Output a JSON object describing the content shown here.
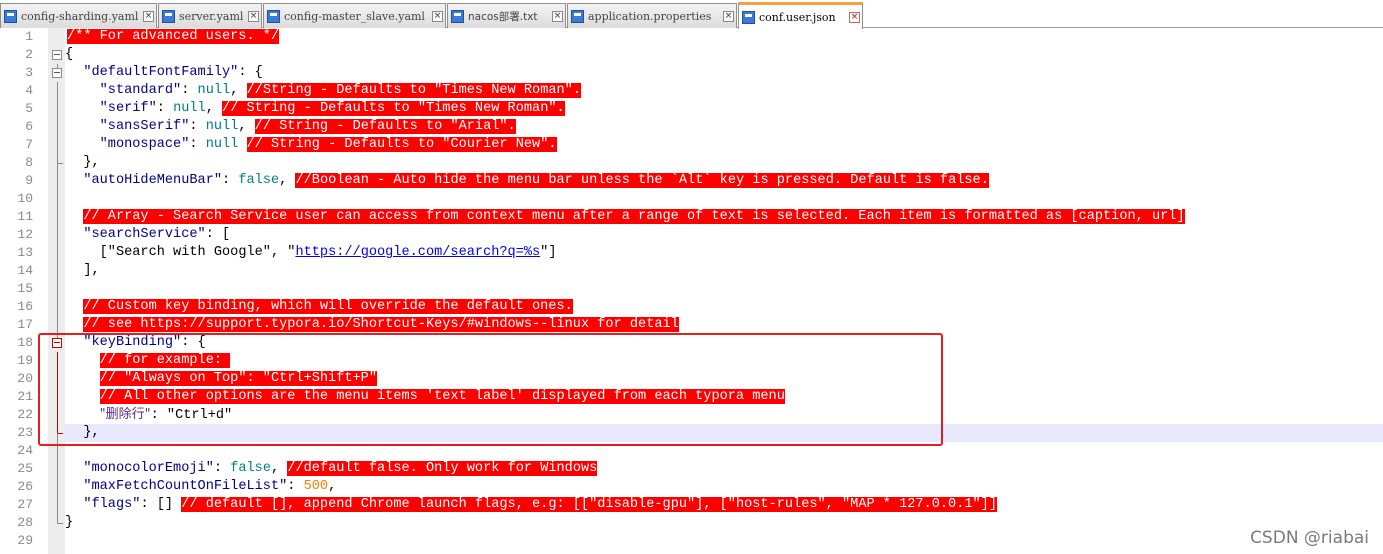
{
  "tabs": [
    {
      "label": "config-sharding.yaml",
      "active": false
    },
    {
      "label": "server.yaml",
      "active": false
    },
    {
      "label": "config-master_slave.yaml",
      "active": false
    },
    {
      "label": "nacos部署.txt",
      "active": false
    },
    {
      "label": "application.properties",
      "active": false
    },
    {
      "label": "conf.user.json",
      "active": true
    }
  ],
  "editor": {
    "lines": {
      "l1_comment": "/** For advanced users. */",
      "l2_brace": "{",
      "l3_key": "\"defaultFontFamily\"",
      "l3_rest": ": {",
      "l4_key": "\"standard\"",
      "l4_sep": ": ",
      "l4_val": "null",
      "l4_comma": ", ",
      "l4_comment": "//String - Defaults to \"Times New Roman\".",
      "l5_key": "\"serif\"",
      "l5_sep": ": ",
      "l5_val": "null",
      "l5_comma": ", ",
      "l5_comment": "// String - Defaults to \"Times New Roman\".",
      "l6_key": "\"sansSerif\"",
      "l6_sep": ": ",
      "l6_val": "null",
      "l6_comma": ", ",
      "l6_comment": "// String - Defaults to \"Arial\".",
      "l7_key": "\"monospace\"",
      "l7_sep": ": ",
      "l7_val": "null",
      "l7_comma": " ",
      "l7_comment": "// String - Defaults to \"Courier New\".",
      "l8_text": "},",
      "l9_key": "\"autoHideMenuBar\"",
      "l9_sep": ": ",
      "l9_val": "false",
      "l9_comma": ", ",
      "l9_comment": "//Boolean - Auto hide the menu bar unless the `Alt` key is pressed. Default is false.",
      "l11_comment": "// Array - Search Service user can access from context menu after a range of text is selected. Each item is formatted as [caption, url]",
      "l12_key": "\"searchService\"",
      "l12_rest": ": [",
      "l13_pre": "[\"Search with Google\", \"",
      "l13_url": "https://google.com/search?q=%s",
      "l13_post": "\"]",
      "l14_text": "],",
      "l16_comment": "// Custom key binding, which will override the default ones.",
      "l17_comment": "// see https://support.typora.io/Shortcut-Keys/#windows--linux for detail",
      "l18_key": "\"keyBinding\"",
      "l18_rest": ": {",
      "l19_comment": "// for example: ",
      "l20_comment": "// \"Always on Top\": \"Ctrl+Shift+P\"",
      "l21_comment": "// All other options are the menu items 'text label' displayed from each typora menu",
      "l22_key": "\"删除行\"",
      "l22_rest": ": \"Ctrl+d\"",
      "l23_text": "},",
      "l25_key": "\"monocolorEmoji\"",
      "l25_sep": ": ",
      "l25_val": "false",
      "l25_comma": ", ",
      "l25_comment": "//default false. Only work for Windows",
      "l26_key": "\"maxFetchCountOnFileList\"",
      "l26_sep": ": ",
      "l26_val": "500",
      "l26_comma": ",",
      "l27_key": "\"flags\"",
      "l27_rest": ": [] ",
      "l27_comment": "// default [], append Chrome launch flags, e.g: [[\"disable-gpu\"], [\"host-rules\", \"MAP * 127.0.0.1\"]]",
      "l28_text": "}"
    }
  },
  "line_numbers": [
    "1",
    "2",
    "3",
    "4",
    "5",
    "6",
    "7",
    "8",
    "9",
    "10",
    "11",
    "12",
    "13",
    "14",
    "15",
    "16",
    "17",
    "18",
    "19",
    "20",
    "21",
    "22",
    "23",
    "24",
    "25",
    "26",
    "27",
    "28",
    "29"
  ],
  "watermark": "CSDN @riabai",
  "colors": {
    "highlight": "#ff0000",
    "key": "#00008b",
    "keyword": "#008080",
    "number": "#ff8000",
    "annotation_box": "#e02020",
    "active_tab": "#f7a23c"
  }
}
